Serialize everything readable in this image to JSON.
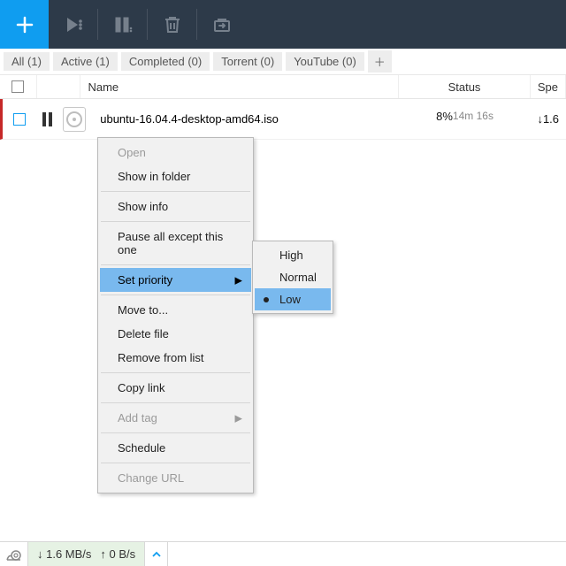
{
  "filters": {
    "all": "All (1)",
    "active": "Active (1)",
    "completed": "Completed (0)",
    "torrent": "Torrent (0)",
    "youtube": "YouTube (0)",
    "plus": "＋"
  },
  "header": {
    "name": "Name",
    "status": "Status",
    "speed": "Spe"
  },
  "row": {
    "name": "ubuntu-16.04.4-desktop-amd64.iso",
    "percent": "8%",
    "eta": "14m 16s",
    "progress_pct": 8,
    "speed": "↓1.6"
  },
  "menu": {
    "open": "Open",
    "show_in_folder": "Show in folder",
    "show_info": "Show info",
    "pause_except": "Pause all except this one",
    "set_priority": "Set priority",
    "move_to": "Move to...",
    "delete_file": "Delete file",
    "remove": "Remove from list",
    "copy_link": "Copy link",
    "add_tag": "Add tag",
    "schedule": "Schedule",
    "change_url": "Change URL"
  },
  "priority": {
    "high": "High",
    "normal": "Normal",
    "low": "Low"
  },
  "statusbar": {
    "down": "↓  1.6 MB/s",
    "up": "↑  0 B/s"
  }
}
